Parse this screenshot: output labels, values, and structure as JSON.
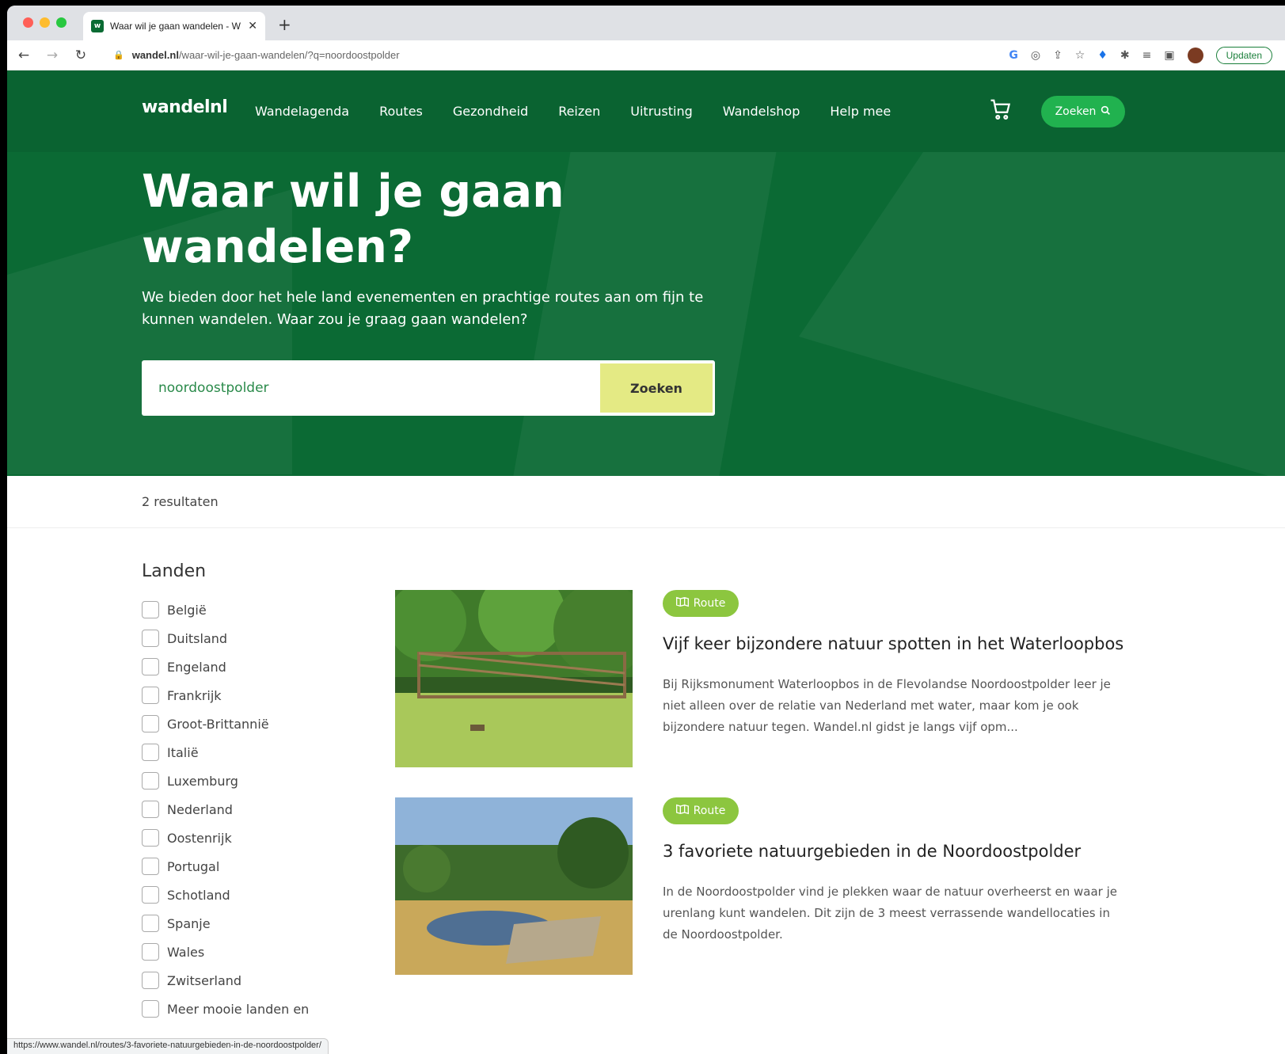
{
  "browser": {
    "tab_title": "Waar wil je gaan wandelen - W",
    "url_domain": "wandel.nl",
    "url_path": "/waar-wil-je-gaan-wandelen/?q=noordoostpolder",
    "update_label": "Updaten",
    "status_url": "https://www.wandel.nl/routes/3-favoriete-natuurgebieden-in-de-noordoostpolder/"
  },
  "nav": {
    "logo": "wandelnl",
    "items": [
      "Wandelagenda",
      "Routes",
      "Gezondheid",
      "Reizen",
      "Uitrusting",
      "Wandelshop",
      "Help mee"
    ],
    "search_label": "Zoeken"
  },
  "hero": {
    "title": "Waar wil je gaan wandelen?",
    "subtitle": "We bieden door het hele land evenementen en prachtige routes aan om fijn te kunnen wandelen. Waar zou je graag gaan wandelen?",
    "search_value": "noordoostpolder",
    "search_button": "Zoeken"
  },
  "results": {
    "count_text": "2 resultaten"
  },
  "filters": {
    "title": "Landen",
    "items": [
      "België",
      "Duitsland",
      "Engeland",
      "Frankrijk",
      "Groot-Brittannië",
      "Italië",
      "Luxemburg",
      "Nederland",
      "Oostenrijk",
      "Portugal",
      "Schotland",
      "Spanje",
      "Wales",
      "Zwitserland",
      "Meer mooie landen en"
    ]
  },
  "cards": [
    {
      "badge": "Route",
      "title": "Vijf keer bijzondere natuur spotten in het Waterloopbos",
      "description": "Bij Rijksmonument Waterloopbos in de Flevolandse Noordoostpolder leer je niet alleen over de relatie van Nederland met water, maar kom je ook bijzondere natuur tegen. Wandel.nl gidst je langs vijf opm..."
    },
    {
      "badge": "Route",
      "title": "3 favoriete natuurgebieden in de Noordoostpolder",
      "description": "In de Noordoostpolder vind je plekken waar de natuur overheerst en waar je urenlang kunt wandelen. Dit zijn de 3 meest verrassende wandellocaties in de Noordoostpolder."
    }
  ],
  "colors": {
    "brand_green": "#0b6a34",
    "accent_green": "#21b24f",
    "badge_green": "#8cc63f",
    "search_button": "#e4ea84"
  }
}
